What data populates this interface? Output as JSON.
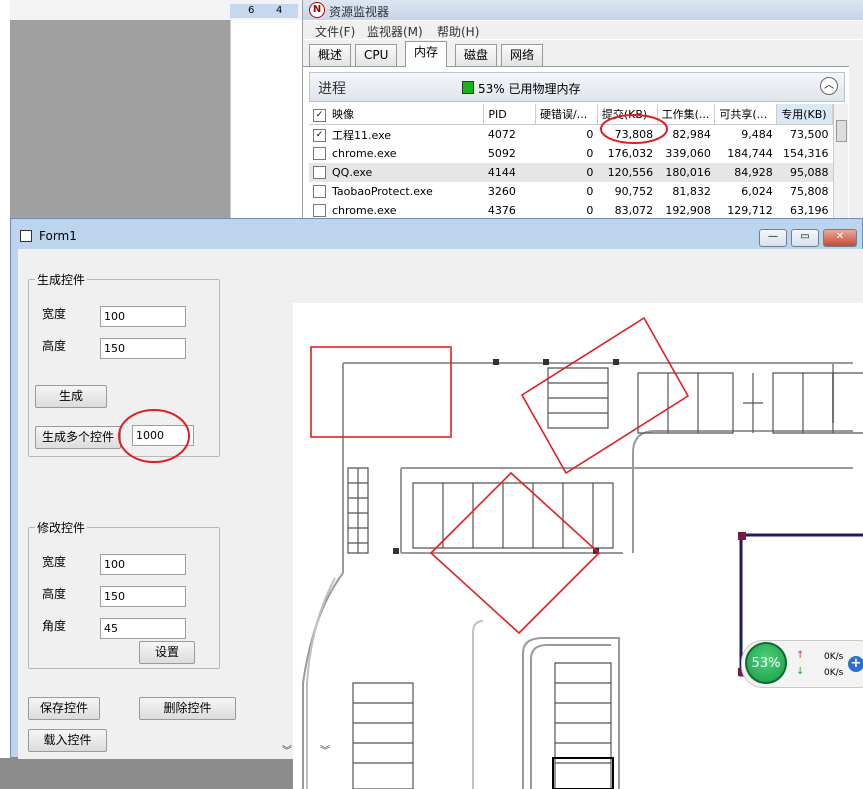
{
  "background": {
    "status_nums": [
      "6",
      "4"
    ]
  },
  "resmon": {
    "title": "资源监视器",
    "menu": [
      "文件(F)",
      "监视器(M)",
      "帮助(H)"
    ],
    "tabs": [
      "概述",
      "CPU",
      "内存",
      "磁盘",
      "网络"
    ],
    "active_tab": "内存",
    "section": {
      "label": "进程",
      "summary": "53% 已用物理内存"
    },
    "columns": [
      "映像",
      "PID",
      "硬错误/...",
      "提交(KB)",
      "工作集(...",
      "可共享(...",
      "专用(KB)"
    ],
    "rows": [
      {
        "checked": true,
        "image": "工程11.exe",
        "pid": "4072",
        "hard": "0",
        "commit": "73,808",
        "ws": "82,984",
        "share": "9,484",
        "private": "73,500"
      },
      {
        "checked": false,
        "image": "chrome.exe",
        "pid": "5092",
        "hard": "0",
        "commit": "176,032",
        "ws": "339,060",
        "share": "184,744",
        "private": "154,316"
      },
      {
        "checked": false,
        "image": "QQ.exe",
        "pid": "4144",
        "hard": "0",
        "commit": "120,556",
        "ws": "180,016",
        "share": "84,928",
        "private": "95,088"
      },
      {
        "checked": false,
        "image": "TaobaoProtect.exe",
        "pid": "3260",
        "hard": "0",
        "commit": "90,752",
        "ws": "81,832",
        "share": "6,024",
        "private": "75,808"
      },
      {
        "checked": false,
        "image": "chrome.exe",
        "pid": "4376",
        "hard": "0",
        "commit": "83,072",
        "ws": "192,908",
        "share": "129,712",
        "private": "63,196"
      }
    ]
  },
  "form": {
    "title": "Form1",
    "group_generate": {
      "legend": "生成控件",
      "width_label": "宽度",
      "width_value": "100",
      "height_label": "高度",
      "height_value": "150",
      "generate_btn": "生成",
      "generate_many_btn": "生成多个控件",
      "count_value": "1000"
    },
    "group_modify": {
      "legend": "修改控件",
      "width_label": "宽度",
      "width_value": "100",
      "height_label": "高度",
      "height_value": "150",
      "angle_label": "角度",
      "angle_value": "45",
      "set_btn": "设置"
    },
    "save_btn": "保存控件",
    "delete_btn": "删除控件",
    "load_btn": "载入控件"
  },
  "widget": {
    "percent": "53%",
    "up_speed": "0K/s",
    "down_speed": "0K/s"
  },
  "colors": {
    "annotation_red": "#e02020",
    "form_frame": "#bcd4ec"
  }
}
